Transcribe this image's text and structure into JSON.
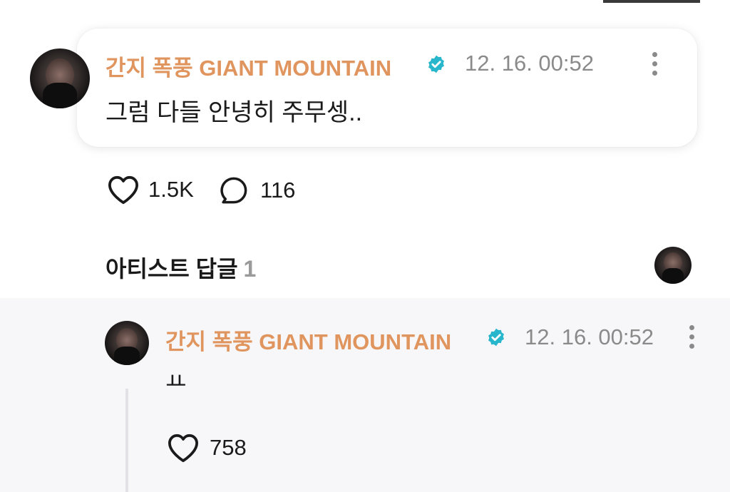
{
  "post": {
    "author": "간지 폭풍 GIANT MOUNTAIN",
    "time": "12. 16. 00:52",
    "text": "그럼 다들 안녕히 주무셍..",
    "likes": "1.5K",
    "comments": "116"
  },
  "artist_replies": {
    "title": "아티스트 답글",
    "count": "1"
  },
  "reply": {
    "author": "간지 폭풍 GIANT MOUNTAIN",
    "time": "12. 16. 00:52",
    "text": "ㅛ",
    "likes": "758"
  },
  "colors": {
    "author": "#e0955e",
    "verified_badge": "#27b6cc",
    "muted": "#8a8a8a",
    "reply_background": "#f7f7f9"
  },
  "icons": [
    "verified-badge-icon",
    "more-options-icon",
    "heart-icon",
    "comment-bubble-icon",
    "avatar"
  ]
}
